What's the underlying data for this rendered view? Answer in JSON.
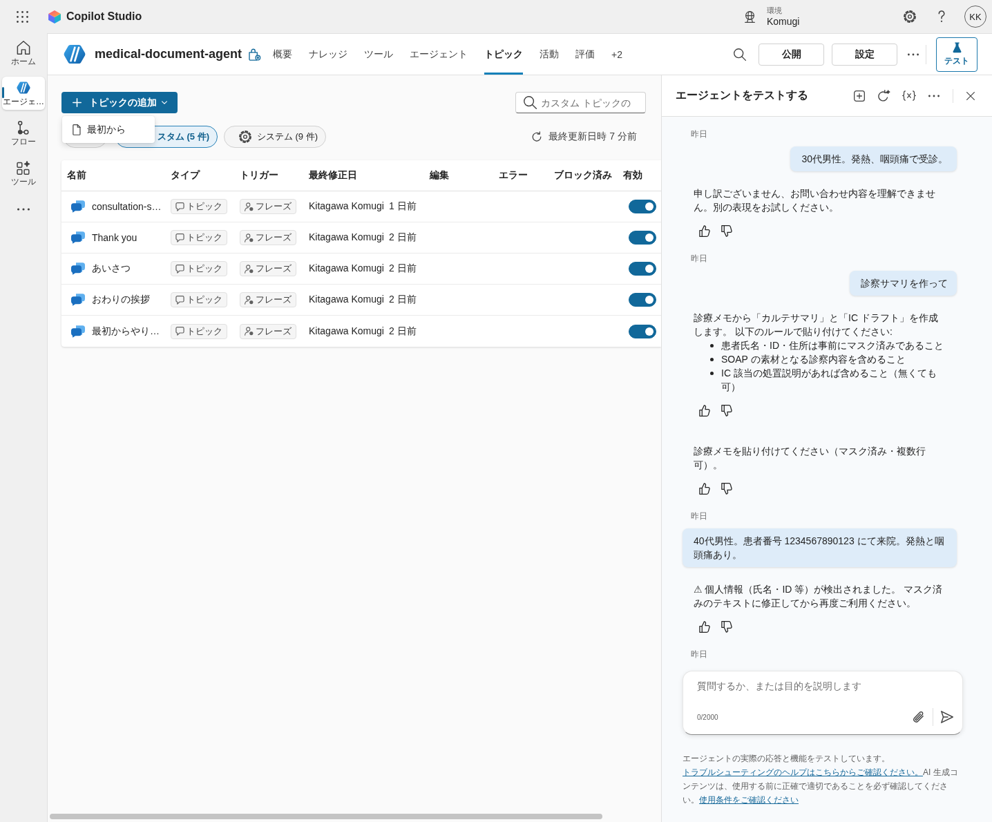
{
  "top_bar": {
    "app_name": "Copilot Studio",
    "environment_label": "環境",
    "environment_name": "Komugi",
    "avatar": "KK"
  },
  "rail": [
    {
      "label": "ホーム",
      "selected": false
    },
    {
      "label": "エージェ…",
      "selected": true
    },
    {
      "label": "フロー",
      "selected": false
    },
    {
      "label": "ツール",
      "selected": false
    }
  ],
  "agent_header": {
    "name": "medical-document-agent",
    "tabs": [
      {
        "label": "概要",
        "selected": false
      },
      {
        "label": "ナレッジ",
        "selected": false
      },
      {
        "label": "ツール",
        "selected": false
      },
      {
        "label": "エージェント",
        "selected": false
      },
      {
        "label": "トピック",
        "selected": true
      },
      {
        "label": "活動",
        "selected": false
      },
      {
        "label": "評価",
        "selected": false
      },
      {
        "label": "+2",
        "selected": false
      }
    ],
    "buttons": [
      "公開",
      "設定"
    ],
    "test_button": {
      "label": "テスト",
      "pressed": true
    }
  },
  "topics": {
    "add_button": {
      "label": "トピックの追加",
      "expanded": true
    },
    "add_menu": [
      "最初から"
    ],
    "search": {
      "placeholder": "カスタム トピックの"
    },
    "filters": [
      {
        "selected": false
      },
      {
        "label": "スタム (5 件)",
        "selected": true
      },
      {
        "label": "システム (9 件)",
        "selected": false
      }
    ],
    "refresh_status": "最終更新日時 7 分前",
    "table": {
      "columns": [
        "名前",
        "タイプ",
        "トリガー",
        "最終修正日",
        "編集",
        "エラー",
        "ブロック済み",
        "有効"
      ],
      "rows": [
        {
          "name": "consultation-s…",
          "type": "トピック",
          "trigger": "フレーズ",
          "modified_by": "Kitagawa Komugi",
          "modified": "1 日前",
          "enabled": true
        },
        {
          "name": "Thank you",
          "type": "トピック",
          "trigger": "フレーズ",
          "modified_by": "Kitagawa Komugi",
          "modified": "2 日前",
          "enabled": true
        },
        {
          "name": "あいさつ",
          "type": "トピック",
          "trigger": "フレーズ",
          "modified_by": "Kitagawa Komugi",
          "modified": "2 日前",
          "enabled": true
        },
        {
          "name": "おわりの挨拶",
          "type": "トピック",
          "trigger": "フレーズ",
          "modified_by": "Kitagawa Komugi",
          "modified": "2 日前",
          "enabled": true
        },
        {
          "name": "最初からやり…",
          "type": "トピック",
          "trigger": "フレーズ",
          "modified_by": "Kitagawa Komugi",
          "modified": "2 日前",
          "enabled": true
        }
      ]
    }
  },
  "test_panel": {
    "title": "エージェントをテストする",
    "messages": [
      {
        "kind": "timestamp",
        "text": "昨日"
      },
      {
        "kind": "user",
        "text": "30代男性。発熱、咽頭痛で受診。"
      },
      {
        "kind": "bot",
        "text": "申し訳ございません、お問い合わせ内容を理解できません。別の表現をお試しください。"
      },
      {
        "kind": "timestamp",
        "text": "昨日"
      },
      {
        "kind": "user",
        "text": "診察サマリを作って"
      },
      {
        "kind": "bot",
        "text": "診療メモから「カルテサマリ」と「IC ドラフト」を作成します。 以下のルールで貼り付けてください:",
        "bullets": [
          "患者氏名・ID・住所は事前にマスク済みであること",
          "SOAP の素材となる診察内容を含めること",
          "IC 該当の処置説明があれば含めること（無くても可）"
        ]
      },
      {
        "kind": "bot",
        "text": "診療メモを貼り付けてください（マスク済み・複数行可）。"
      },
      {
        "kind": "timestamp",
        "text": "昨日"
      },
      {
        "kind": "user",
        "text": "40代男性。患者番号 1234567890123 にて来院。発熱と咽頭痛あり。"
      },
      {
        "kind": "bot",
        "text": "⚠ 個人情報（氏名・ID 等）が検出されました。 マスク済みのテキストに修正してから再度ご利用ください。"
      },
      {
        "kind": "timestamp",
        "text": "昨日"
      }
    ],
    "input": {
      "placeholder": "質問するか、または目的を説明します",
      "counter": "0/2000"
    },
    "disclaimer": [
      {
        "kind": "text",
        "text": "エージェントの実際の応答と機能をテストしています。"
      },
      {
        "kind": "link",
        "text": "トラブルシューティングのヘルプはこちらからご確認ください。"
      },
      {
        "kind": "text",
        "text": "AI 生成コンテンツは、使用する前に正確で適切であることを必ず確認してください。"
      },
      {
        "kind": "link",
        "text": "使用条件をご確認ください"
      }
    ]
  }
}
